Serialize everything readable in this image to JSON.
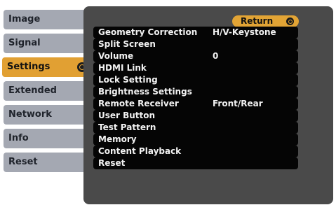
{
  "tabs": [
    {
      "label": "Image",
      "active": false
    },
    {
      "label": "Signal",
      "active": false
    },
    {
      "label": "Settings",
      "active": true
    },
    {
      "label": "Extended",
      "active": false
    },
    {
      "label": "Network",
      "active": false
    },
    {
      "label": "Info",
      "active": false
    },
    {
      "label": "Reset",
      "active": false
    }
  ],
  "return_label": "Return",
  "menu": [
    {
      "label": "Geometry Correction",
      "value": "H/V-Keystone"
    },
    {
      "label": "Split Screen",
      "value": ""
    },
    {
      "label": "Volume",
      "value": "0"
    },
    {
      "label": "HDMI Link",
      "value": ""
    },
    {
      "label": "Lock Setting",
      "value": ""
    },
    {
      "label": "Brightness Settings",
      "value": ""
    },
    {
      "label": "Remote Receiver",
      "value": "Front/Rear"
    },
    {
      "label": "User Button",
      "value": ""
    },
    {
      "label": "Test Pattern",
      "value": ""
    },
    {
      "label": "Memory",
      "value": ""
    },
    {
      "label": "Content Playback",
      "value": ""
    },
    {
      "label": "Reset",
      "value": ""
    }
  ],
  "colors": {
    "tab_inactive": "#a4a8b2",
    "tab_active": "#e1a033",
    "panel": "#4a4a4a",
    "row": "#050505",
    "accent": "#e2a435"
  }
}
